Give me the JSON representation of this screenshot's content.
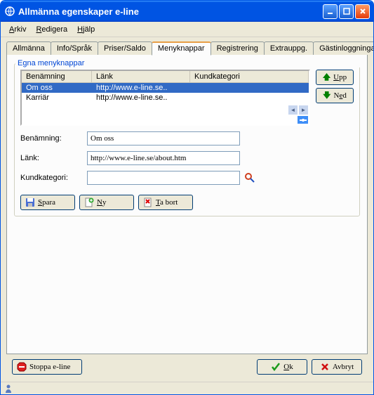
{
  "window": {
    "title": "Allmänna egenskaper e-line"
  },
  "menu": {
    "file": "Arkiv",
    "edit": "Redigera",
    "help": "Hjälp"
  },
  "tabs": {
    "general": "Allmänna",
    "info": "Info/Språk",
    "prices": "Priser/Saldo",
    "menubuttons": "Menyknappar",
    "registration": "Registrering",
    "extra": "Extrauppg.",
    "guest": "Gästinloggningar"
  },
  "panel": {
    "legend": "Egna menyknappar",
    "columns": {
      "name": "Benämning",
      "link": "Länk",
      "category": "Kundkategori"
    },
    "rows": [
      {
        "name": "Om oss",
        "link": "http://www.e-line.se..",
        "category": ""
      },
      {
        "name": "Karriär",
        "link": "http://www.e-line.se..",
        "category": ""
      }
    ],
    "updown": {
      "up": "Upp",
      "down": "Ned"
    },
    "fields": {
      "name_label": "Benämning:",
      "name_value": "Om oss",
      "link_label": "Länk:",
      "link_value": "http://www.e-line.se/about.htm",
      "category_label": "Kundkategori:",
      "category_value": ""
    },
    "actions": {
      "save": "Spara",
      "new": "Ny",
      "delete": "Ta bort"
    }
  },
  "footer": {
    "stop": "Stoppa e-line",
    "ok": "Ok",
    "cancel": "Avbryt"
  }
}
